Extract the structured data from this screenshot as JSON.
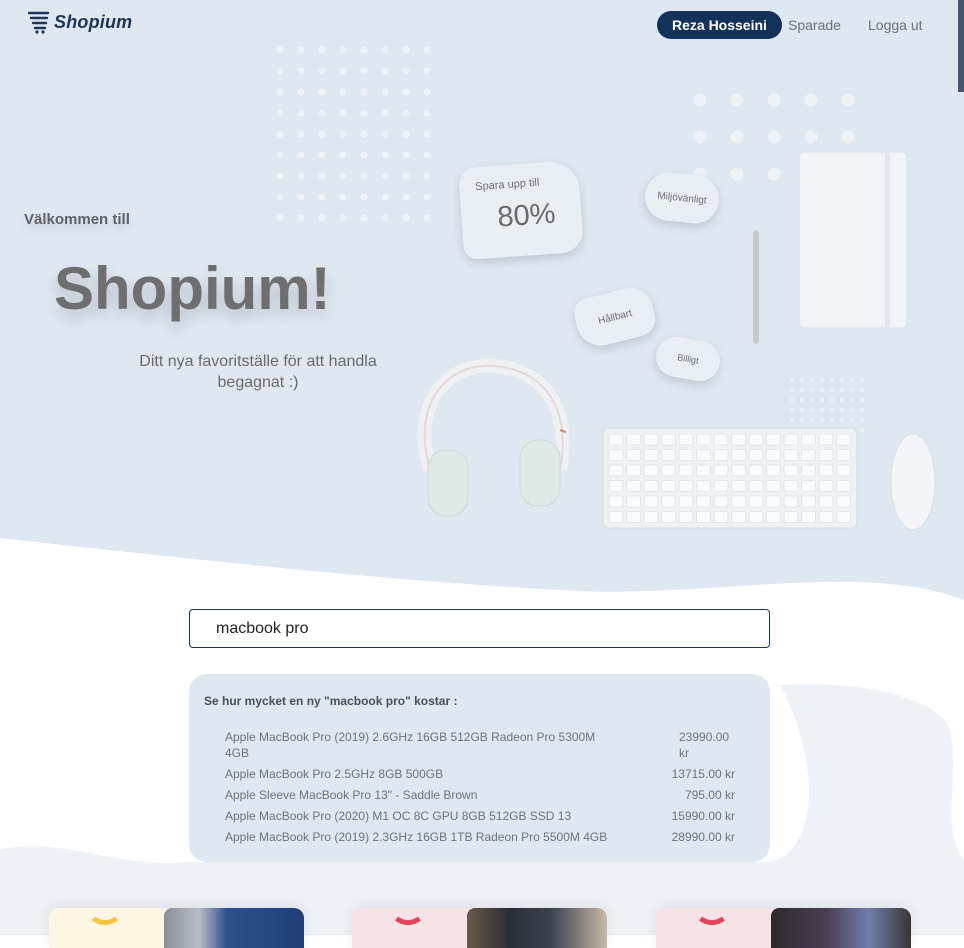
{
  "header": {
    "logo_text": "Shopium",
    "user_button": "Reza Hosseini",
    "saved_link": "Sparade",
    "logout_link": "Logga ut"
  },
  "hero": {
    "welcome": "Välkommen till",
    "title": "Shopium!",
    "tagline": "Ditt nya favoritställe för att handla begagnat :)",
    "bubbles": {
      "save_label": "Spara upp till",
      "save_value": "80%",
      "eco": "Miljövänligt",
      "sustainable": "Hållbart",
      "cheap": "Billigt"
    }
  },
  "search": {
    "value": "macbook pro"
  },
  "price_panel": {
    "title": "Se hur mycket en ny \"macbook pro\" kostar :",
    "items": [
      {
        "name": "Apple MacBook Pro (2019) 2.6GHz 16GB 512GB Radeon Pro 5300M 4GB",
        "price": "23990.00 kr"
      },
      {
        "name": "Apple MacBook Pro 2.5GHz 8GB 500GB",
        "price": "13715.00 kr"
      },
      {
        "name": "Apple Sleeve MacBook Pro 13\" - Saddle Brown",
        "price": "795.00 kr"
      },
      {
        "name": "Apple MacBook Pro (2020) M1 OC 8C GPU 8GB 512GB SSD 13",
        "price": "15990.00 kr"
      },
      {
        "name": "Apple MacBook Pro (2019) 2.3GHz 16GB 1TB Radeon Pro 5500M 4GB",
        "price": "28990.00 kr"
      }
    ]
  },
  "colors": {
    "hero_bg": "#dfe7f1",
    "brand": "#13325a",
    "card1": "#fdf6e3",
    "card2": "#f7e3e5",
    "card3": "#f7e3e5"
  }
}
